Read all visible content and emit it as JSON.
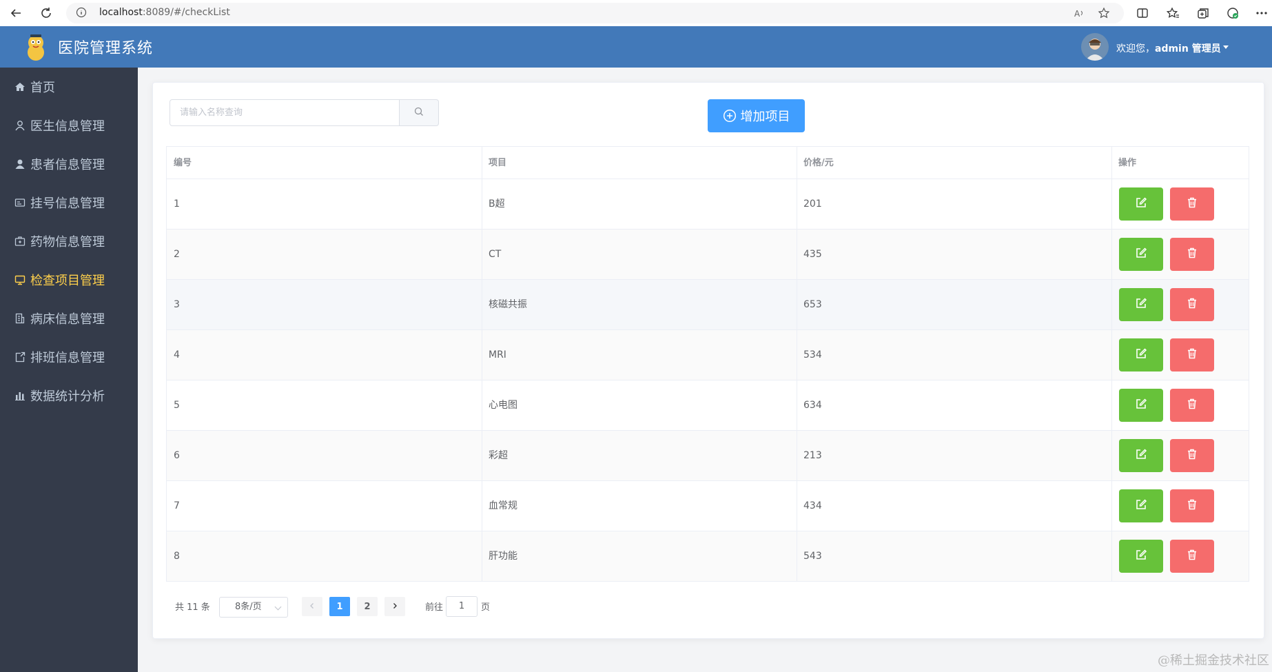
{
  "browser": {
    "url_host": "localhost",
    "url_rest": ":8089/#/checkList"
  },
  "header": {
    "title": "医院管理系统",
    "greeting": "欢迎您，",
    "username": "admin 管理员"
  },
  "sidebar": {
    "items": [
      {
        "label": "首页",
        "icon": "home-icon"
      },
      {
        "label": "医生信息管理",
        "icon": "user-outline-icon"
      },
      {
        "label": "患者信息管理",
        "icon": "user-solid-icon"
      },
      {
        "label": "挂号信息管理",
        "icon": "postcard-icon"
      },
      {
        "label": "药物信息管理",
        "icon": "first-aid-kit-icon"
      },
      {
        "label": "检查项目管理",
        "icon": "monitor-icon",
        "active": true
      },
      {
        "label": "病床信息管理",
        "icon": "office-building-icon"
      },
      {
        "label": "排班信息管理",
        "icon": "calendar-share-icon"
      },
      {
        "label": "数据统计分析",
        "icon": "bar-chart-icon"
      }
    ]
  },
  "toolbar": {
    "search_placeholder": "请输入名称查询",
    "add_label": "增加项目"
  },
  "table": {
    "headers": [
      "编号",
      "项目",
      "价格/元",
      "操作"
    ],
    "rows": [
      {
        "id": "1",
        "name": "B超",
        "price": "201"
      },
      {
        "id": "2",
        "name": "CT",
        "price": "435"
      },
      {
        "id": "3",
        "name": "核磁共振",
        "price": "653"
      },
      {
        "id": "4",
        "name": "MRI",
        "price": "534"
      },
      {
        "id": "5",
        "name": "心电图",
        "price": "634"
      },
      {
        "id": "6",
        "name": "彩超",
        "price": "213"
      },
      {
        "id": "7",
        "name": "血常规",
        "price": "434"
      },
      {
        "id": "8",
        "name": "肝功能",
        "price": "543"
      }
    ]
  },
  "pagination": {
    "total": "共 11 条",
    "page_size": "8条/页",
    "pages": [
      "1",
      "2"
    ],
    "current": "1",
    "goto_label": "前往",
    "goto_value": "1",
    "page_unit": "页"
  },
  "watermark": "@稀土掘金技术社区",
  "colors": {
    "header_bg": "#4279b9",
    "sidebar_bg": "#343b4a",
    "active_menu": "#ffd04b",
    "primary": "#409eff",
    "success": "#67c23a",
    "danger": "#f56c6c"
  }
}
